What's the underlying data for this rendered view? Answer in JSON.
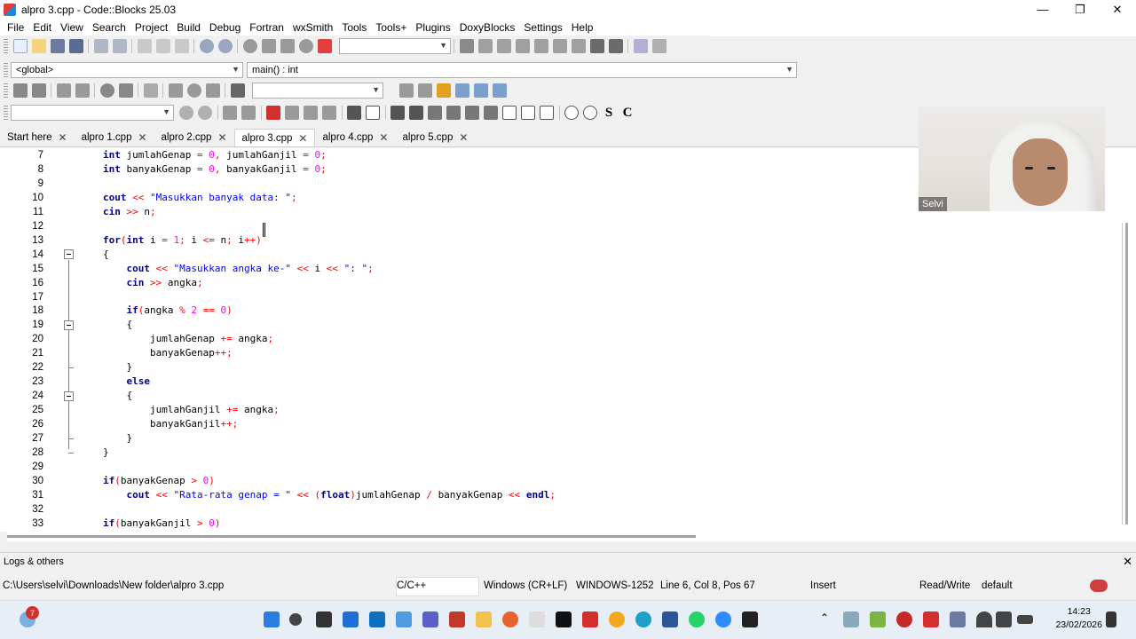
{
  "window": {
    "title": "alpro 3.cpp - Code::Blocks 25.03"
  },
  "menu": [
    "File",
    "Edit",
    "View",
    "Search",
    "Project",
    "Build",
    "Debug",
    "Fortran",
    "wxSmith",
    "Tools",
    "Tools+",
    "Plugins",
    "DoxyBlocks",
    "Settings",
    "Help"
  ],
  "scope": {
    "global": "<global>",
    "function": "main() : int"
  },
  "tabs": [
    {
      "label": "Start here"
    },
    {
      "label": "alpro 1.cpp"
    },
    {
      "label": "alpro 2.cpp"
    },
    {
      "label": "alpro 3.cpp"
    },
    {
      "label": "alpro 4.cpp"
    },
    {
      "label": "alpro 5.cpp"
    }
  ],
  "code": [
    {
      "n": "7",
      "t": "int jumlahGenap = 0, jumlahGanjil = 0;"
    },
    {
      "n": "8",
      "t": "int banyakGenap = 0, banyakGanjil = 0;"
    },
    {
      "n": "9",
      "t": ""
    },
    {
      "n": "10",
      "t": "cout << \"Masukkan banyak data: \";"
    },
    {
      "n": "11",
      "t": "cin >> n;"
    },
    {
      "n": "12",
      "t": ""
    },
    {
      "n": "13",
      "t": "for(int i = 1; i <= n; i++)"
    },
    {
      "n": "14",
      "t": "{"
    },
    {
      "n": "15",
      "t": "    cout << \"Masukkan angka ke-\" << i << \": \";"
    },
    {
      "n": "16",
      "t": "    cin >> angka;"
    },
    {
      "n": "17",
      "t": ""
    },
    {
      "n": "18",
      "t": "    if(angka % 2 == 0)"
    },
    {
      "n": "19",
      "t": "    {"
    },
    {
      "n": "20",
      "t": "        jumlahGenap += angka;"
    },
    {
      "n": "21",
      "t": "        banyakGenap++;"
    },
    {
      "n": "22",
      "t": "    }"
    },
    {
      "n": "23",
      "t": "    else"
    },
    {
      "n": "24",
      "t": "    {"
    },
    {
      "n": "25",
      "t": "        jumlahGanjil += angka;"
    },
    {
      "n": "26",
      "t": "        banyakGanjil++;"
    },
    {
      "n": "27",
      "t": "    }"
    },
    {
      "n": "28",
      "t": "}"
    },
    {
      "n": "29",
      "t": ""
    },
    {
      "n": "30",
      "t": "if(banyakGenap > 0)"
    },
    {
      "n": "31",
      "t": "    cout << \"Rata-rata genap = \" << (float)jumlahGenap / banyakGenap << endl;"
    },
    {
      "n": "32",
      "t": ""
    },
    {
      "n": "33",
      "t": "if(banyakGanjil > 0)"
    }
  ],
  "logs": {
    "label": "Logs & others"
  },
  "status": {
    "path": "C:\\Users\\selvi\\Downloads\\New folder\\alpro 3.cpp",
    "language": "C/C++",
    "eol": "Windows (CR+LF)",
    "encoding": "WINDOWS-1252",
    "position": "Line 6, Col 8, Pos 67",
    "mode": "Insert",
    "access": "Read/Write",
    "profile": "default"
  },
  "webcam": {
    "name": "Selvi"
  },
  "taskbar": {
    "badge": "7",
    "time": "14:23",
    "date": "23/02/2026"
  },
  "colors": {
    "keyword": "#00008b",
    "string": "#0000ff",
    "number": "#ff00ff",
    "operator": "#ff0000"
  }
}
